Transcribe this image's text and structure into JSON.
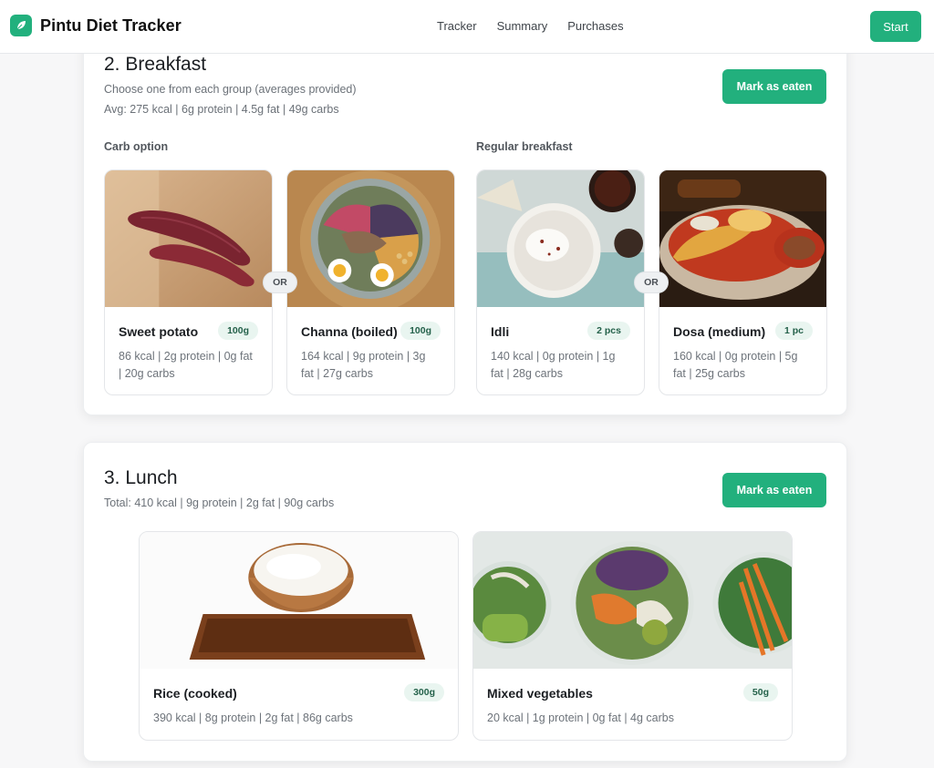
{
  "app": {
    "name": "Pintu Diet Tracker"
  },
  "nav": {
    "links": [
      "Tracker",
      "Summary",
      "Purchases"
    ],
    "start_label": "Start"
  },
  "breakfast": {
    "title": "2. Breakfast",
    "subtitle": "Choose one from each group (averages provided)",
    "avg": "Avg: 275 kcal | 6g protein | 4.5g fat | 49g carbs",
    "button": "Mark as eaten",
    "groups": [
      {
        "label": "Carb option",
        "items": [
          {
            "name": "Sweet potato",
            "qty": "100g",
            "nutrition": "86 kcal | 2g protein | 0g fat | 20g carbs",
            "image": "sweet-potato"
          },
          {
            "name": "Channa (boiled)",
            "qty": "100g",
            "nutrition": "164 kcal | 9g protein | 3g fat | 27g carbs",
            "image": "chickpea-bowl"
          }
        ]
      },
      {
        "label": "Regular breakfast",
        "items": [
          {
            "name": "Idli",
            "qty": "2 pcs",
            "nutrition": "140 kcal | 0g protein | 1g fat | 28g carbs",
            "image": "idli"
          },
          {
            "name": "Dosa (medium)",
            "qty": "1 pc",
            "nutrition": "160 kcal | 0g protein | 5g fat | 25g carbs",
            "image": "dosa"
          }
        ]
      }
    ],
    "or_label": "OR"
  },
  "lunch": {
    "title": "3. Lunch",
    "total": "Total: 410 kcal | 9g protein | 2g fat | 90g carbs",
    "button": "Mark as eaten",
    "items": [
      {
        "name": "Rice (cooked)",
        "qty": "300g",
        "nutrition": "390 kcal | 8g protein | 2g fat | 86g carbs",
        "image": "rice-bowl"
      },
      {
        "name": "Mixed vegetables",
        "qty": "50g",
        "nutrition": "20 kcal | 1g protein | 0g fat | 4g carbs",
        "image": "salad-bowls"
      }
    ]
  },
  "colors": {
    "accent": "#22b07d",
    "badge_bg": "#e9f5f0",
    "badge_text": "#24614a"
  }
}
